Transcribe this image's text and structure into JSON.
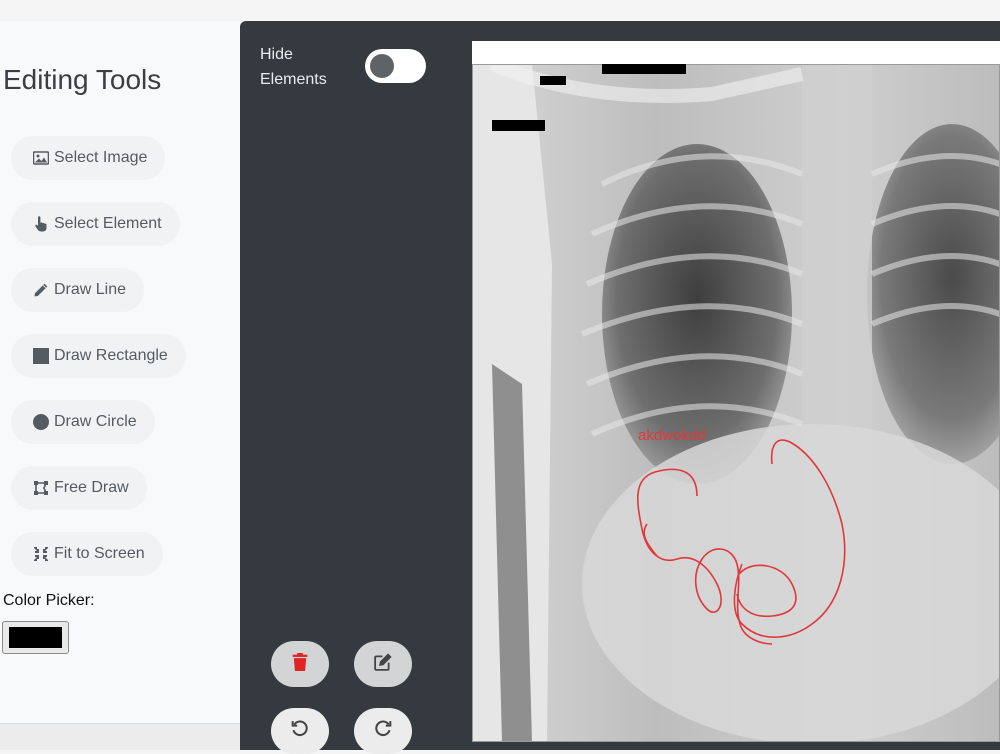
{
  "sidebar": {
    "title": "Editing Tools",
    "tools": [
      {
        "label": "Select Image",
        "icon": "image-icon"
      },
      {
        "label": "Select Element",
        "icon": "pointer-hand-icon"
      },
      {
        "label": "Draw Line",
        "icon": "pencil-icon"
      },
      {
        "label": "Draw Rectangle",
        "icon": "square-icon"
      },
      {
        "label": "Draw Circle",
        "icon": "circle-icon"
      },
      {
        "label": "Free Draw",
        "icon": "draw-polygon-icon"
      },
      {
        "label": "Fit to Screen",
        "icon": "compress-icon"
      }
    ],
    "color_picker_label": "Color Picker:",
    "color_value": "#000000"
  },
  "controls": {
    "hide_elements_label": "Hide Elements",
    "hide_elements_on": false,
    "buttons": [
      {
        "name": "delete",
        "icon": "trash-icon",
        "color": "#e02424"
      },
      {
        "name": "edit",
        "icon": "edit-icon",
        "color": "#444444"
      },
      {
        "name": "undo",
        "icon": "undo-icon",
        "color": "#444444"
      },
      {
        "name": "redo",
        "icon": "redo-icon",
        "color": "#444444"
      }
    ]
  },
  "canvas": {
    "annotation_text": "akdwokdd",
    "annotation_color": "#e0383a"
  }
}
